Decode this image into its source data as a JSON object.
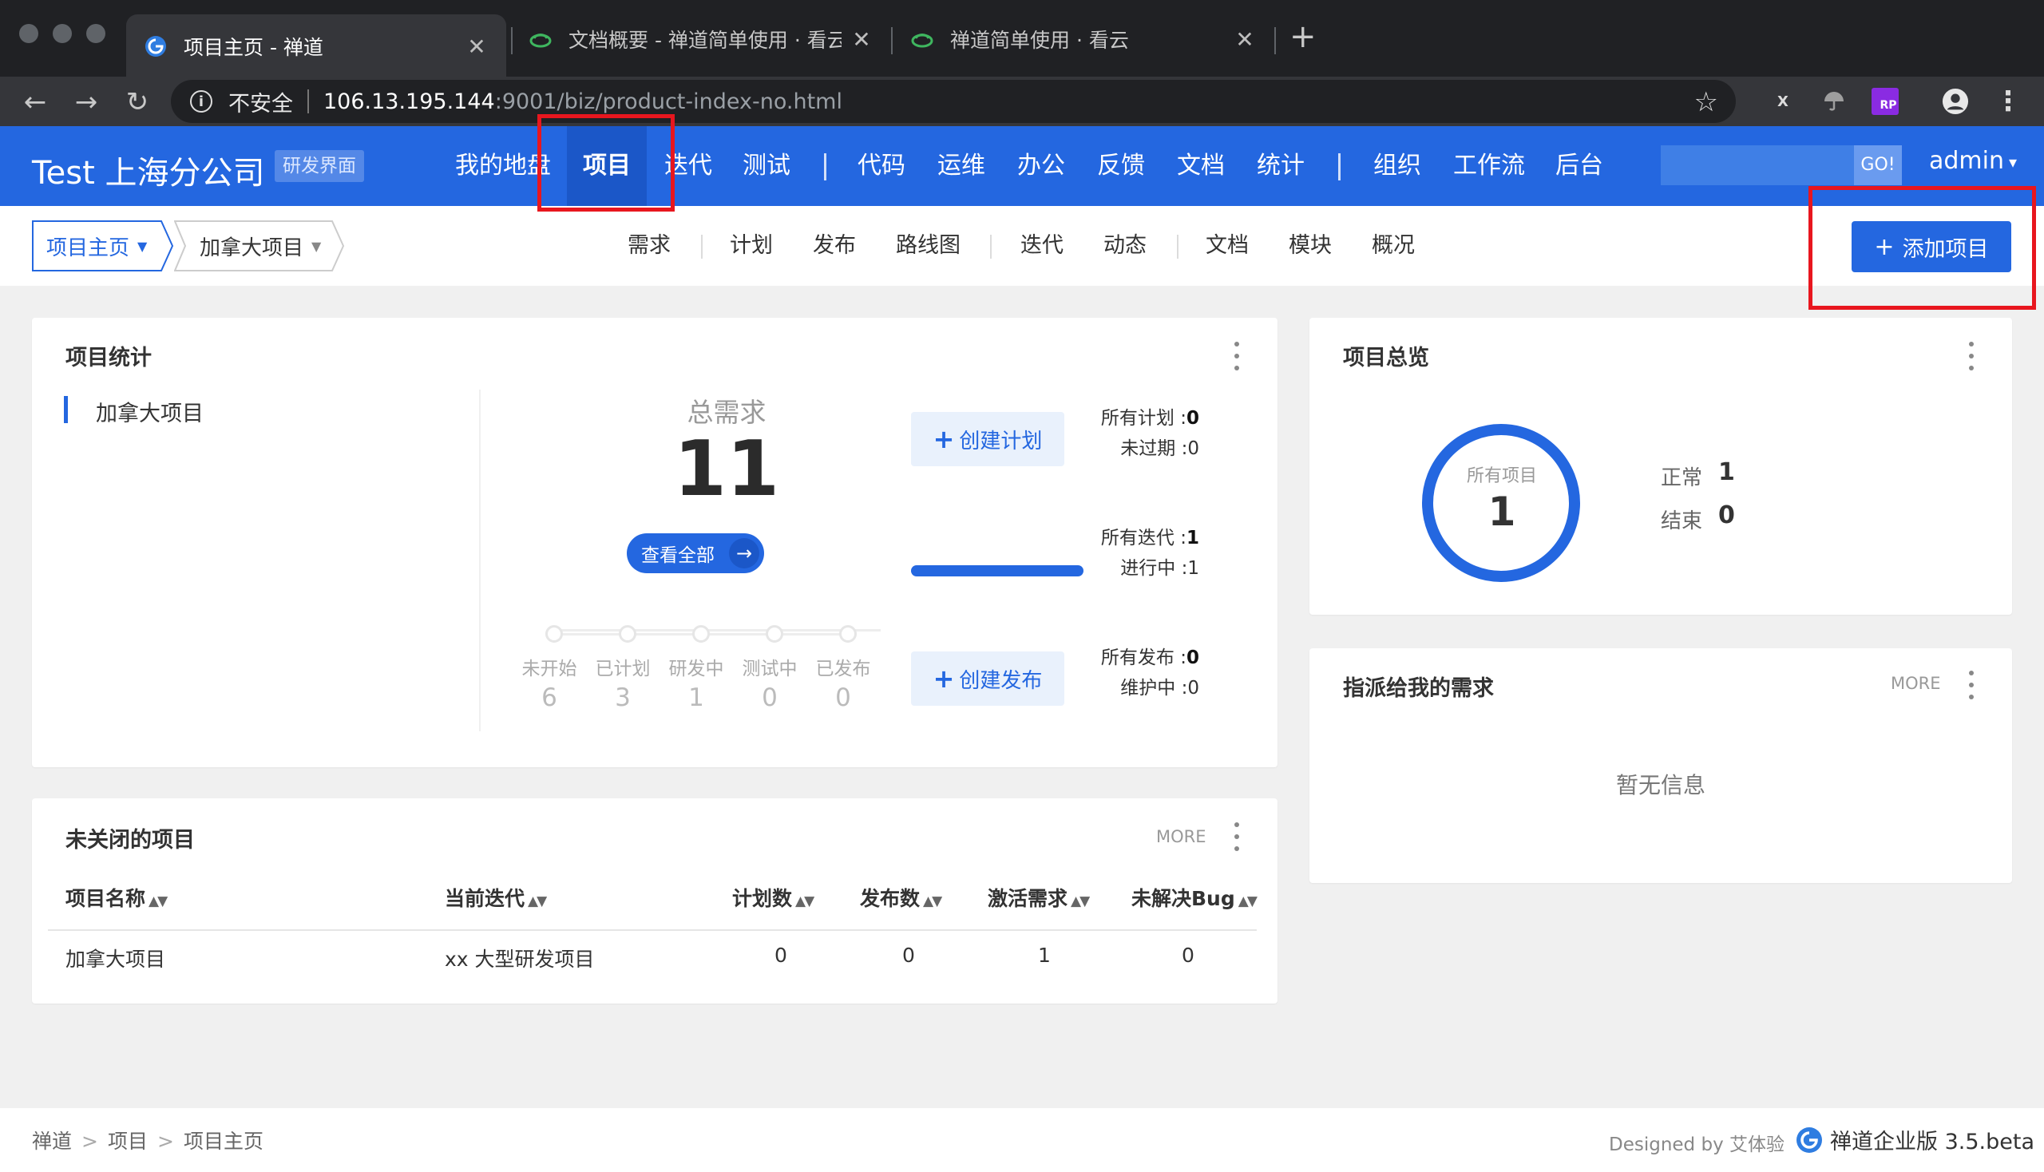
{
  "browser": {
    "tabs": [
      {
        "title": "项目主页 - 禅道",
        "active": true
      },
      {
        "title": "文档概要 - 禅道简单使用 · 看云",
        "active": false
      },
      {
        "title": "禅道简单使用 · 看云",
        "active": false
      }
    ],
    "close_glyph": "✕",
    "newtab_glyph": "+",
    "insecure_label": "不安全",
    "url_host": "106.13.195.144",
    "url_path": ":9001/biz/product-index-no.html",
    "ext_label_x": "X",
    "ext_label_rp": "RP"
  },
  "header": {
    "brand": "Test 上海分公司",
    "badge": "研发界面",
    "nav": [
      "我的地盘",
      "项目",
      "迭代",
      "测试",
      "代码",
      "运维",
      "办公",
      "反馈",
      "文档",
      "统计",
      "组织",
      "工作流",
      "后台"
    ],
    "active_nav": "项目",
    "search_button": "GO!",
    "user": "admin"
  },
  "subnav": {
    "crumb_primary": "项目主页",
    "crumb_secondary": "加拿大项目",
    "items": [
      "需求",
      "计划",
      "发布",
      "路线图",
      "迭代",
      "动态",
      "文档",
      "模块",
      "概况"
    ],
    "add_button": "添加项目",
    "accent": "#2467e0"
  },
  "stats_panel": {
    "title": "项目统计",
    "project": "加拿大项目",
    "total_label": "总需求",
    "total_value": "11",
    "view_all": "查看全部",
    "steps": [
      {
        "label": "未开始",
        "value": "6"
      },
      {
        "label": "已计划",
        "value": "3"
      },
      {
        "label": "研发中",
        "value": "1"
      },
      {
        "label": "测试中",
        "value": "0"
      },
      {
        "label": "已发布",
        "value": "0"
      }
    ],
    "create_plan": "创建计划",
    "create_release": "创建发布",
    "plans": {
      "all_label": "所有计划 :",
      "all_value": "0",
      "unexpired_label": "未过期 :",
      "unexpired_value": "0"
    },
    "iterations": {
      "all_label": "所有迭代 :",
      "all_value": "1",
      "ongoing_label": "进行中 :",
      "ongoing_value": "1",
      "progress": 1
    },
    "releases": {
      "all_label": "所有发布 :",
      "all_value": "0",
      "maintain_label": "维护中 :",
      "maintain_value": "0"
    }
  },
  "overview_panel": {
    "title": "项目总览",
    "ring_label": "所有项目",
    "ring_value": "1",
    "normal_label": "正常",
    "normal_value": "1",
    "closed_label": "结束",
    "closed_value": "0"
  },
  "assigned_panel": {
    "title": "指派给我的需求",
    "more": "MORE",
    "empty": "暂无信息"
  },
  "unclosed_panel": {
    "title": "未关闭的项目",
    "more": "MORE",
    "columns": [
      "项目名称",
      "当前迭代",
      "计划数",
      "发布数",
      "激活需求",
      "未解决Bug"
    ],
    "rows": [
      [
        "加拿大项目",
        "xx 大型研发项目",
        "0",
        "0",
        "1",
        "0"
      ]
    ]
  },
  "footer": {
    "crumbs": [
      "禅道",
      "项目",
      "项目主页"
    ],
    "designed": "Designed by 艾体验",
    "version": "禅道企业版 3.5.beta"
  }
}
